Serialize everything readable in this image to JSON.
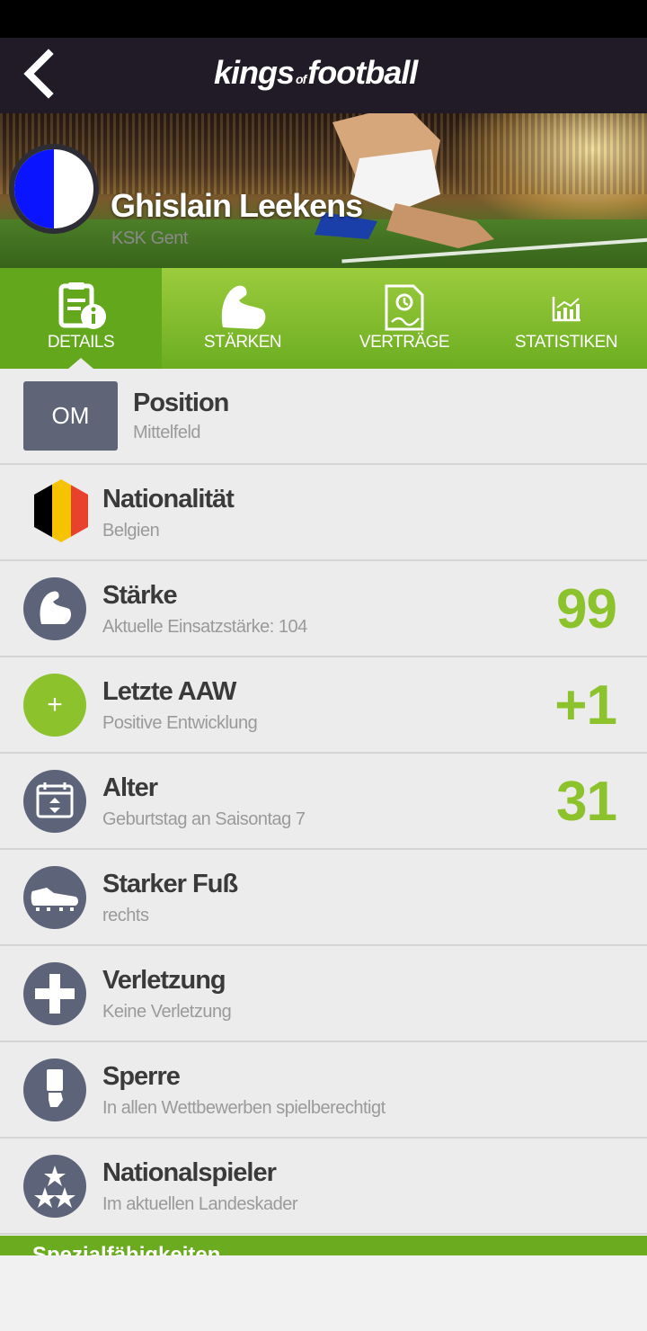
{
  "header": {
    "logo_main": "kings",
    "logo_of": "of",
    "logo_end": "football"
  },
  "player": {
    "name": "Ghislain Leekens",
    "club": "KSK Gent"
  },
  "tabs": [
    {
      "label": "DETAILS",
      "icon": "details-icon",
      "active": true
    },
    {
      "label": "STÄRKEN",
      "icon": "muscle-icon"
    },
    {
      "label": "VERTRÄGE",
      "icon": "contract-icon"
    },
    {
      "label": "STATISTIKEN",
      "icon": "chart-icon"
    }
  ],
  "rows": {
    "position": {
      "badge": "OM",
      "title": "Position",
      "sub": "Mittelfeld"
    },
    "nationality": {
      "title": "Nationalität",
      "sub": "Belgien",
      "flag_colors": [
        "#000000",
        "#f5c300",
        "#e8412c"
      ]
    },
    "strength": {
      "title": "Stärke",
      "sub": "Aktuelle Einsatzstärke: 104",
      "value": "99"
    },
    "aaw": {
      "title": "Letzte AAW",
      "sub": "Positive Entwicklung",
      "value": "+1",
      "badge_symbol": "+"
    },
    "age": {
      "title": "Alter",
      "sub": "Geburtstag an Saisontag 7",
      "value": "31"
    },
    "foot": {
      "title": "Starker Fuß",
      "sub": "rechts"
    },
    "injury": {
      "title": "Verletzung",
      "sub": "Keine Verletzung"
    },
    "ban": {
      "title": "Sperre",
      "sub": "In allen Wettbewerben spielberechtigt"
    },
    "national": {
      "title": "Nationalspieler",
      "sub": "Im aktuellen Landeskader"
    }
  },
  "special": {
    "label": "Spezialfähigkeiten"
  },
  "colors": {
    "accent": "#8cc22c",
    "badge": "#5d6479",
    "appbar": "#211a27"
  }
}
